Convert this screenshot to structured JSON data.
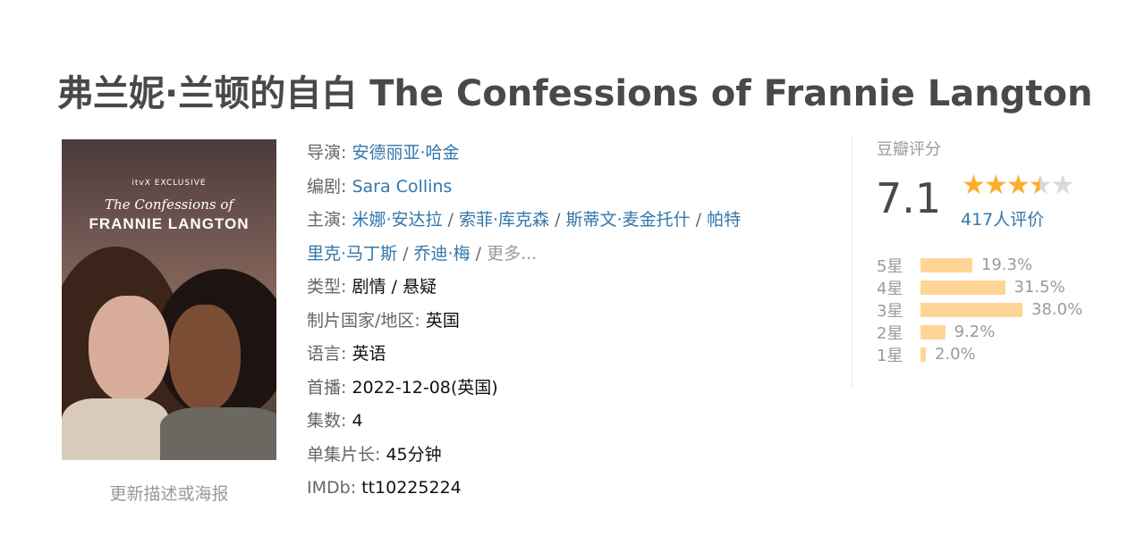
{
  "title": "弗兰妮·兰顿的自白 The Confessions of Frannie Langton",
  "poster": {
    "brand": "itvX EXCLUSIVE",
    "subtitle": "The Confessions of",
    "title": "FRANNIE LANGTON",
    "update_link": "更新描述或海报"
  },
  "info": {
    "director_label": "导演",
    "director": "安德丽亚·哈金",
    "writer_label": "编剧",
    "writer": "Sara Collins",
    "cast_label": "主演",
    "cast": [
      "米娜·安达拉",
      "索菲·库克森",
      "斯蒂文·麦金托什",
      "帕特里克·马丁斯",
      "乔迪·梅"
    ],
    "cast_line1": [
      "米娜·安达拉",
      "索菲·库克森",
      "斯蒂文·麦金托什",
      "帕特"
    ],
    "cast_line2_tail": "里克·马丁斯",
    "more": "更多...",
    "genre_label": "类型",
    "genre": "剧情 / 悬疑",
    "country_label": "制片国家/地区",
    "country": "英国",
    "language_label": "语言",
    "language": "英语",
    "premiere_label": "首播",
    "premiere": "2022-12-08(英国)",
    "episodes_label": "集数",
    "episodes": "4",
    "runtime_label": "单集片长",
    "runtime": "45分钟",
    "imdb_label": "IMDb",
    "imdb": "tt10225224"
  },
  "rating": {
    "title": "豆瓣评分",
    "score": "7.1",
    "stars": 3.5,
    "votes": "417人评价",
    "star_color": "#ffac2d",
    "bar_color": "#ffd596",
    "breakdown": [
      {
        "label": "5星",
        "percent": 19.3,
        "text": "19.3%"
      },
      {
        "label": "4星",
        "percent": 31.5,
        "text": "31.5%"
      },
      {
        "label": "3星",
        "percent": 38.0,
        "text": "38.0%"
      },
      {
        "label": "2星",
        "percent": 9.2,
        "text": "9.2%"
      },
      {
        "label": "1星",
        "percent": 2.0,
        "text": "2.0%"
      }
    ]
  },
  "link_color": "#3377aa"
}
